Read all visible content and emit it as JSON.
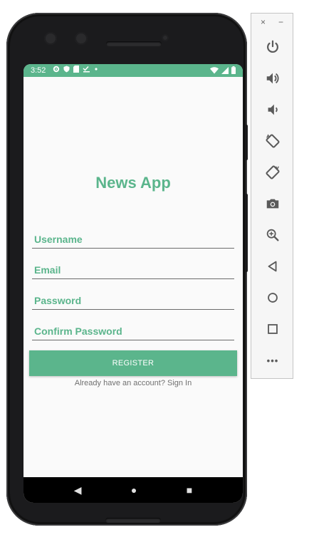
{
  "status_bar": {
    "time": "3:52",
    "icons": [
      "gear-icon",
      "shield-icon",
      "sd-card-icon",
      "checklist-icon",
      "dot-icon"
    ],
    "right_icons": [
      "wifi-icon",
      "signal-icon",
      "battery-icon"
    ]
  },
  "app": {
    "title": "News App",
    "fields": {
      "username_placeholder": "Username",
      "email_placeholder": "Email",
      "password_placeholder": "Password",
      "confirm_password_placeholder": "Confirm Password"
    },
    "register_label": "REGISTER",
    "signin_text": "Already have an account? Sign In"
  },
  "nav_bar": {
    "back": "◀",
    "home": "●",
    "recents": "■"
  },
  "emulator_panel": {
    "close": "×",
    "minimize": "−",
    "tools": [
      "power-icon",
      "volume-up-icon",
      "volume-down-icon",
      "rotate-left-icon",
      "rotate-right-icon",
      "camera-icon",
      "zoom-icon",
      "back-icon",
      "home-icon",
      "overview-icon",
      "more-icon"
    ],
    "more": "•••"
  },
  "colors": {
    "accent": "#5bb58c",
    "screen_bg": "#fafafa",
    "text_muted": "#707070"
  }
}
